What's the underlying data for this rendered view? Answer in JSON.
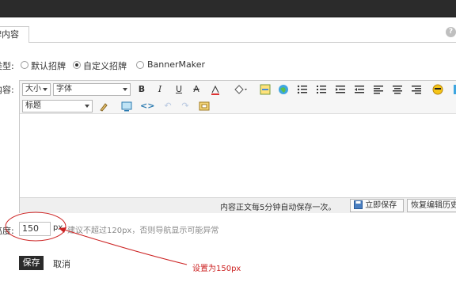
{
  "tab": {
    "label": "牌内容"
  },
  "help_icon": "question-circle-icon",
  "type_row": {
    "label": "类型:",
    "options": [
      {
        "label": "默认招牌",
        "selected": false
      },
      {
        "label": "自定义招牌",
        "selected": true
      },
      {
        "label": "BannerMaker",
        "selected": false
      }
    ]
  },
  "content_row": {
    "label": "内容:"
  },
  "toolbar": {
    "font_size": "大小",
    "font_family": "字体",
    "heading": "标题",
    "bold": "B",
    "italic": "I",
    "underline": "U",
    "strike": "A"
  },
  "status": {
    "autosave_text": "内容正文每5分钟自动保存一次。",
    "save_now": "立即保存",
    "restore": "恢复编辑历史"
  },
  "height_row": {
    "label": "高度:",
    "value": "150",
    "unit": "px",
    "hint": "建议不超过120px，否则导航显示可能异常"
  },
  "actions": {
    "save": "保存",
    "cancel": "取消"
  },
  "annotation": {
    "text": "设置为150px",
    "color": "#cc2222"
  }
}
